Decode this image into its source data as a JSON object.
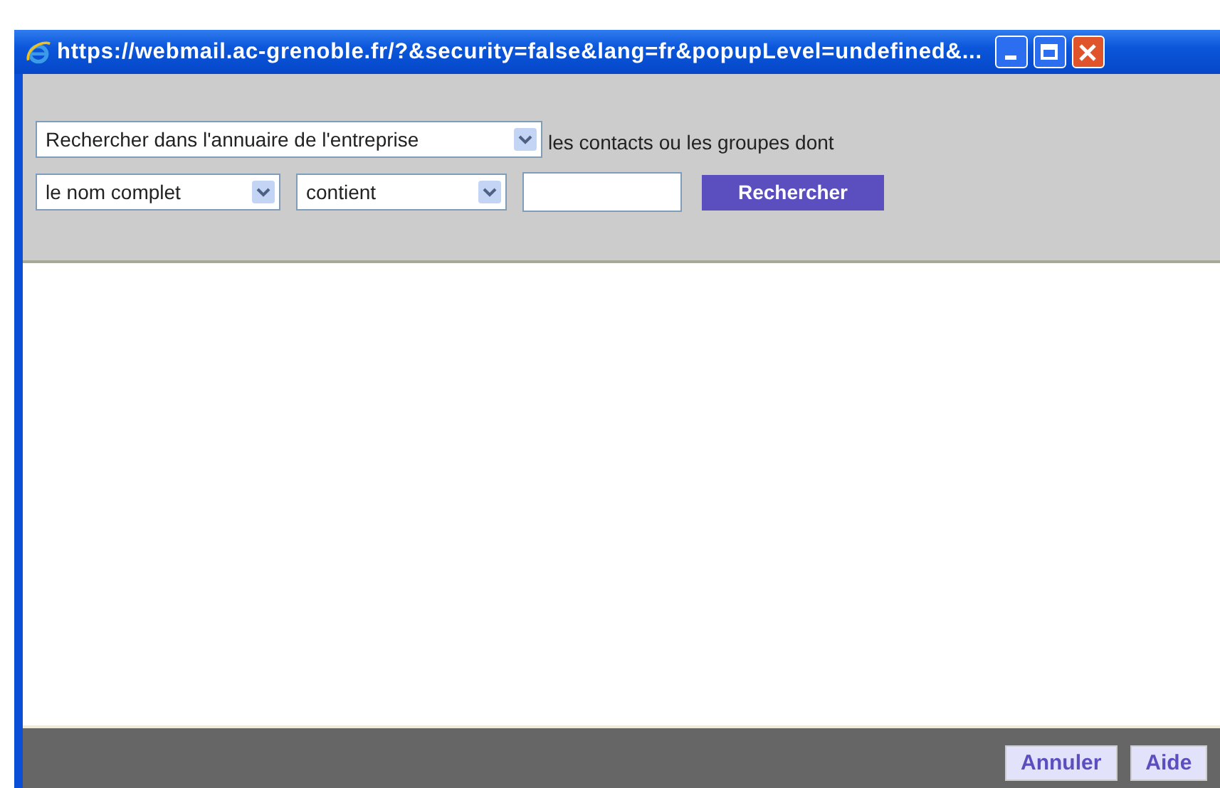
{
  "window": {
    "title": "https://webmail.ac-grenoble.fr/?&security=false&lang=fr&popupLevel=undefined&..."
  },
  "search": {
    "scope": {
      "value": "Rechercher dans l'annuaire de l'entreprise"
    },
    "suffix": "les contacts ou les groupes dont",
    "field": {
      "value": "le nom complet"
    },
    "operator": {
      "value": "contient"
    },
    "button": "Rechercher"
  },
  "buttons": [
    "Annuler",
    "Aide"
  ]
}
